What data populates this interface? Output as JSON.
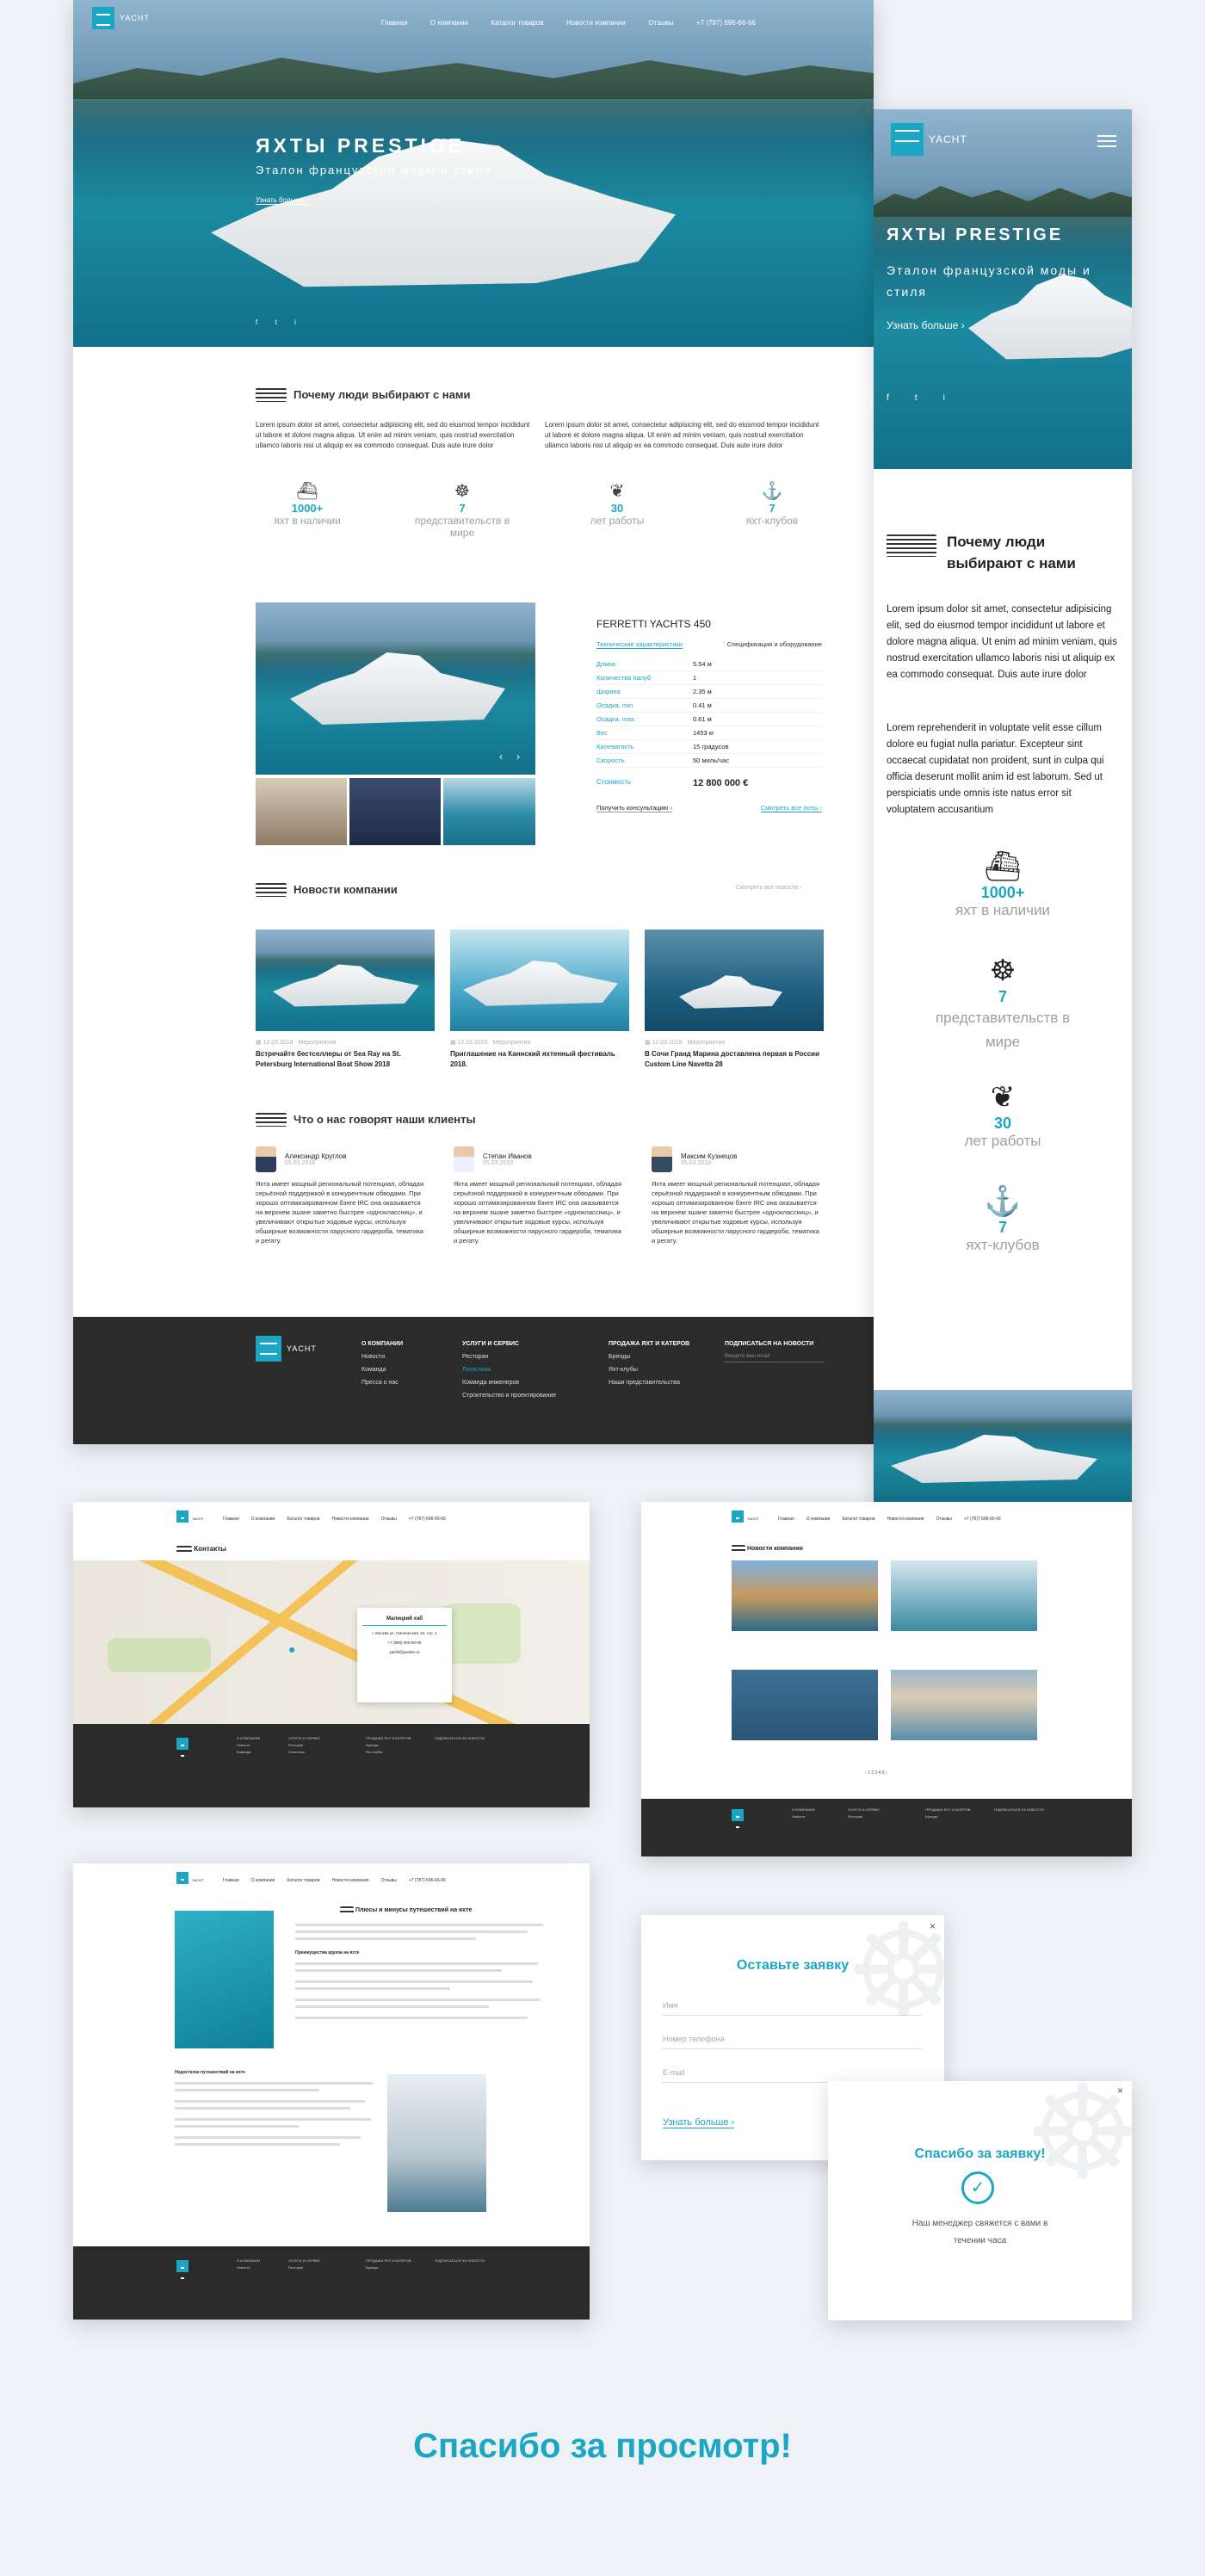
{
  "brand": "YACHT",
  "nav": {
    "items": [
      "Главная",
      "О компании",
      "Каталог товаров",
      "Новости компании",
      "Отзывы"
    ],
    "phone": "+7 (787) 696-66-66"
  },
  "hero": {
    "title": "ЯХТЫ PRESTIGE",
    "subtitle": "Эталон французской моды и стиля",
    "more": "Узнать больше ›",
    "social": [
      "f",
      "t",
      "i"
    ]
  },
  "why": {
    "title": "Почему люди выбирают с нами",
    "col1": "Lorem ipsum dolor sit amet, consectetur adipisicing elit, sed do eiusmod tempor incididunt ut labore et dolore magna aliqua. Ut enim ad minim veniam, quis nostrud exercitation ullamco laboris nisi ut aliquip ex ea commodo consequat. Duis aute irure dolor",
    "col2": "Lorem ipsum dolor sit amet, consectetur adipisicing elit, sed do eiusmod tempor incididunt ut labore et dolore magna aliqua. Ut enim ad minim veniam, quis nostrud exercitation ullamco laboris nisi ut aliquip ex ea commodo consequat. Duis aute irure dolor",
    "stats": [
      {
        "num": "1000+",
        "label": "яхт в наличии"
      },
      {
        "num": "7",
        "label": "представительств в мире"
      },
      {
        "num": "30",
        "label": "лет работы"
      },
      {
        "num": "7",
        "label": "яхт-клубов"
      }
    ]
  },
  "product": {
    "name": "FERRETTI YACHTS 450",
    "tab1": "Технические характеристики",
    "tab2": "Спецификация и оборудование",
    "specs": [
      {
        "k": "Длина",
        "v": "5.54 м"
      },
      {
        "k": "Количество палуб",
        "v": "1"
      },
      {
        "k": "Ширина",
        "v": "2.35 м"
      },
      {
        "k": "Осадка, min",
        "v": "0.41 м"
      },
      {
        "k": "Осадка, max",
        "v": "0.61 м"
      },
      {
        "k": "Вес",
        "v": "1453 кг"
      },
      {
        "k": "Килеватость",
        "v": "15 градусов"
      },
      {
        "k": "Скорость",
        "v": "50 миль/час"
      }
    ],
    "price_label": "Стоимость",
    "price": "12 800 000 €",
    "consult": "Получить консультацию ›",
    "all": "Смотреть все лоты ›"
  },
  "news": {
    "title": "Новости компании",
    "all": "Смотреть все новости ›",
    "items": [
      {
        "date": "12.03.2018",
        "cat": "Мероприятия",
        "title": "Встречайте бестселлеры от Sea Ray на St. Petersburg International Boat Show 2018"
      },
      {
        "date": "12.03.2018",
        "cat": "Мероприятия",
        "title": "Приглашение на Каннский яхтенный фестиваль 2018."
      },
      {
        "date": "12.03.2018",
        "cat": "Мероприятия",
        "title": "В Сочи Гранд Марина доставлена первая в России Custom Line Navetta 28"
      }
    ]
  },
  "reviews": {
    "title": "Что о нас говорят наши клиенты",
    "items": [
      {
        "name": "Александр Круглов",
        "date": "05.03.2018",
        "text": "Яхта имеет мощный региональный потенциал, обладая серьёзной поддержкой в конкурентным обводами. При хорошо оптимизированном бэнге IRC она оказывается на верхнем эшане заметно быстрее «одноклассниц», и увеличивают открытые ходовые курсы, используя обширные возможности парусного гардероба, тематика и регату."
      },
      {
        "name": "Степан Иванов",
        "date": "05.03.2018",
        "text": "Яхта имеет мощный региональный потенциал, обладая серьёзной поддержкой в конкурентным обводами. При хорошо оптимизированном бэнге IRC она оказывается на верхнем эшане заметно быстрее «одноклассниц», и увеличивают открытые ходовые курсы, используя обширные возможности парусного гардероба, тематика и регату."
      },
      {
        "name": "Максим Кузнецов",
        "date": "05.03.2018",
        "text": "Яхта имеет мощный региональный потенциал, обладая серьёзной поддержкой в конкурентным обводами. При хорошо оптимизированном бэнге IRC она оказывается на верхнем эшане заметно быстрее «одноклассниц», и увеличивают открытые ходовые курсы, используя обширные возможности парусного гардероба, тематика и регату."
      }
    ]
  },
  "footer": {
    "col1": {
      "h": "О КОМПАНИИ",
      "items": [
        "Новости",
        "Команда",
        "Пресса о нас"
      ]
    },
    "col2": {
      "h": "УСЛУГИ И СЕРВИС",
      "items": [
        "Ресторан",
        "Логистика",
        "Команда инженеров",
        "Строительство и проектирование"
      ]
    },
    "col3": {
      "h": "ПРОДАЖА ЯХТ И КАТЕРОВ",
      "items": [
        "Бренды",
        "Яхт-клубы",
        "Наши представительства"
      ]
    },
    "col4": {
      "h": "ПОДПИСАТЬСЯ НА НОВОСТИ",
      "placeholder": "Введите ваш email"
    }
  },
  "mobile": {
    "title": "ЯХТЫ PRESTIGE",
    "subtitle": "Эталон французской моды и стиля",
    "more": "Узнать больше ›",
    "why_title": "Почему люди выбирают с нами",
    "p1": "Lorem ipsum dolor sit amet, consectetur adipisicing elit, sed do eiusmod tempor incididunt ut labore et dolore magna aliqua. Ut enim ad minim veniam, quis nostrud exercitation ullamco laboris nisi ut aliquip ex ea commodo consequat. Duis aute irure dolor",
    "p2": "Lorem reprehenderit in voluptate velit esse cillum dolore eu fugiat nulla pariatur. Excepteur sint occaecat cupidatat non proident, sunt in culpa qui officia deserunt mollit anim id est laborum. Sed ut perspiciatis unde omnis iste natus error sit voluptatem accusantium"
  },
  "contacts": {
    "title": "Контакты",
    "card_title": "Малицкий хаб",
    "addr": "г. Москва ул. Смоленская, 34, стр. 1",
    "phone": "+7 (900) 000-00-00",
    "email": "yacht@yandex.ru"
  },
  "newslist": {
    "title": "Новости компании"
  },
  "article": {
    "title": "Плюсы и минусы путешествий на яхте",
    "subhead": "Преимущества круиза на яхте",
    "subhead2": "Недостатки путешествий на яхте"
  },
  "form": {
    "title": "Оставьте заявку",
    "name": "Имя",
    "phone": "Номер телефона",
    "email": "E-mail",
    "submit": "Узнать больше ›"
  },
  "thanks": {
    "title": "Спасибо за заявку!",
    "text": "Наш менеджер свяжется с вами в течении часа"
  },
  "closing": "Спасибо за просмотр!",
  "colors": {
    "accent": "#1ba7c4",
    "footer": "#2b2b2b"
  }
}
